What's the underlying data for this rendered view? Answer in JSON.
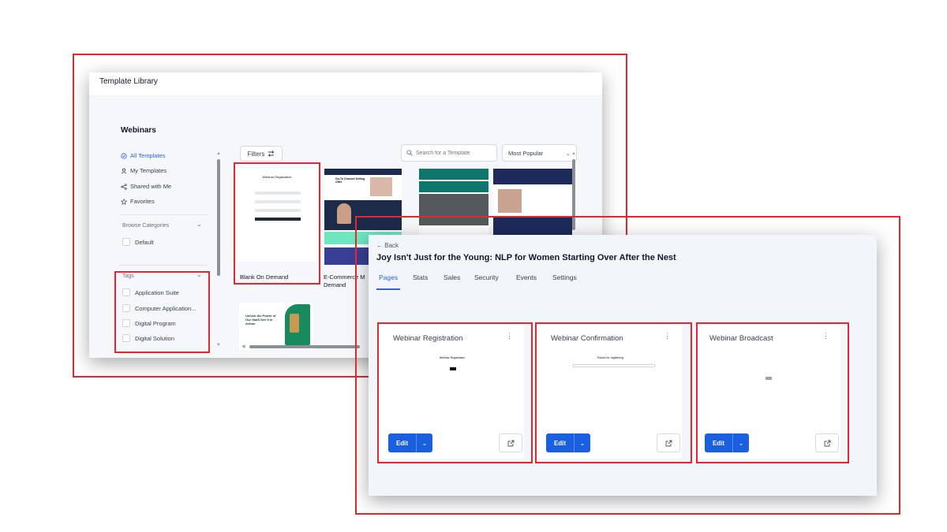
{
  "library": {
    "title": "Template Library",
    "sidebar_title": "Webinars",
    "nav": [
      {
        "label": "All Templates",
        "icon": "check-circle-icon",
        "active": true
      },
      {
        "label": "My Templates",
        "icon": "user-icon",
        "active": false
      },
      {
        "label": "Shared with Me",
        "icon": "share-icon",
        "active": false
      },
      {
        "label": "Favorites",
        "icon": "star-icon",
        "active": false
      }
    ],
    "browse_categories": {
      "label": "Browse Categories",
      "items": [
        "Default"
      ]
    },
    "tags": {
      "label": "Tags",
      "items": [
        "Application Suite",
        "Computer Application...",
        "Digital Program",
        "Digital Solution"
      ]
    },
    "filters_label": "Filters",
    "search_placeholder": "Search for a Template",
    "sort_value": "Most Popular",
    "templates": [
      {
        "name": "Blank On Demand",
        "thumb_title": "Webinar Registration"
      },
      {
        "name": "E-Commerce M Demand",
        "thumb_title": "Go-To Channel Selling Offer"
      },
      {
        "name": "",
        "thumb_title": ""
      },
      {
        "name": "",
        "thumb_title": ""
      },
      {
        "name": "",
        "thumb_title": "Unlock the Power of Our SaaS See It in Action"
      }
    ]
  },
  "detail": {
    "back_label": "Back",
    "title": "Joy Isn't Just for the Young: NLP for Women Starting Over After the Nest",
    "tabs": [
      "Pages",
      "Stats",
      "Sales",
      "Security",
      "Events",
      "Settings"
    ],
    "active_tab": "Pages",
    "pages": [
      {
        "title": "Webinar Registration",
        "edit_label": "Edit",
        "preview_text": "Webinar Registration"
      },
      {
        "title": "Webinar Confirmation",
        "edit_label": "Edit",
        "preview_text": "Thanks for registering"
      },
      {
        "title": "Webinar Broadcast",
        "edit_label": "Edit",
        "preview_text": ""
      }
    ]
  },
  "colors": {
    "highlight": "#e0282e",
    "primary": "#1a5fe0",
    "active_link": "#2563eb"
  }
}
